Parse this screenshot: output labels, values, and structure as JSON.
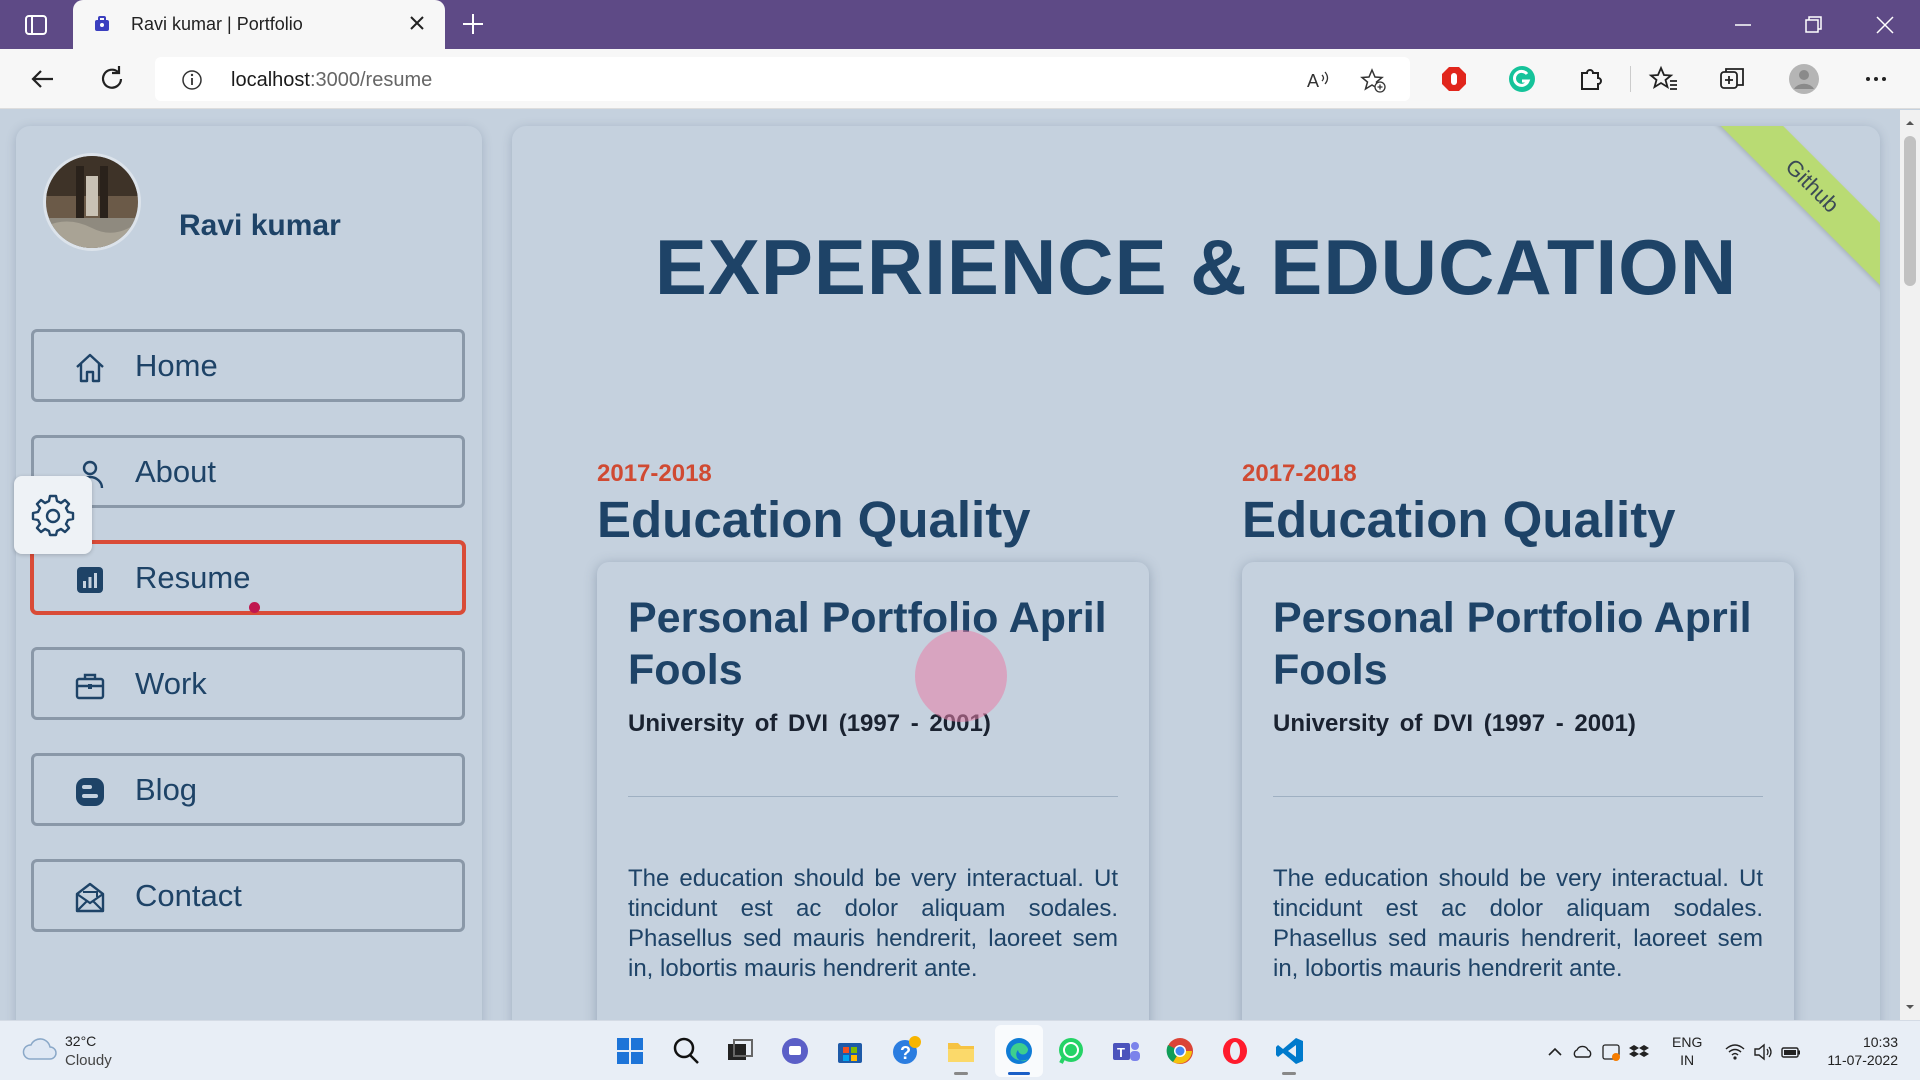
{
  "browser": {
    "tab_title": "Ravi kumar | Portfolio",
    "url_host": "localhost",
    "url_path": ":3000/resume"
  },
  "sidebar": {
    "user_name": "Ravi kumar",
    "nav": [
      {
        "label": "Home",
        "icon": "home-icon"
      },
      {
        "label": "About",
        "icon": "user-icon"
      },
      {
        "label": "Resume",
        "icon": "chart-icon",
        "active": true
      },
      {
        "label": "Work",
        "icon": "briefcase-icon"
      },
      {
        "label": "Blog",
        "icon": "blogger-icon"
      },
      {
        "label": "Contact",
        "icon": "mail-icon"
      }
    ]
  },
  "main": {
    "ribbon": "Github",
    "heading": "EXPERIENCE & EDUCATION",
    "columns": [
      {
        "year": "2017-2018",
        "title": "Education Quality",
        "card": {
          "title": "Personal Portfolio April Fools",
          "subtitle": "University of DVI (1997 - 2001)",
          "body": "The education should be very interactual. Ut tincidunt est ac dolor aliquam sodales. Phasellus sed mauris hendrerit, laoreet sem in, lobortis mauris hendrerit ante."
        }
      },
      {
        "year": "2017-2018",
        "title": "Education Quality",
        "card": {
          "title": "Personal Portfolio April Fools",
          "subtitle": "University of DVI (1997 - 2001)",
          "body": "The education should be very interactual. Ut tincidunt est ac dolor aliquam sodales. Phasellus sed mauris hendrerit, laoreet sem in, lobortis mauris hendrerit ante."
        }
      }
    ]
  },
  "taskbar": {
    "weather_temp": "32°C",
    "weather_desc": "Cloudy",
    "lang_1": "ENG",
    "lang_2": "IN",
    "time": "10:33",
    "date": "11-07-2022"
  },
  "colors": {
    "tabbar": "#5e4a86",
    "page_bg": "#c5d1de",
    "heading": "#1e4367",
    "accent_red": "#d04a32",
    "ribbon": "#b9db73"
  }
}
